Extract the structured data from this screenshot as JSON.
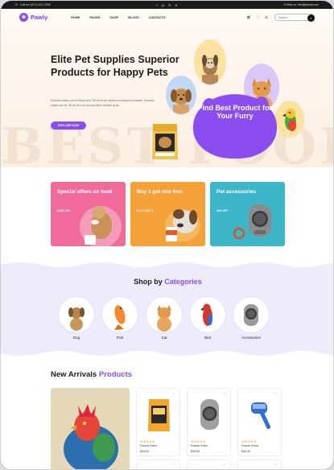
{
  "topbar": {
    "phone": "Call us: (617) 422-2236",
    "email": "Mail us: info@pawly.com",
    "social_icons": [
      "facebook-icon",
      "instagram-icon",
      "pinterest-icon",
      "x-icon"
    ]
  },
  "header": {
    "logo": "Pawly",
    "nav": [
      "HOME",
      "PAGES",
      "SHOP",
      "BLOGS",
      "CONTACTS"
    ],
    "icons": [
      "cart-icon",
      "heart-icon",
      "user-icon"
    ],
    "search_placeholder": "Search...",
    "search_icon": "search-icon"
  },
  "hero": {
    "title": "Elite Pet Supplies Superior Products for Happy Pets",
    "description": "Exerties nobis cum et libero tem. Sit vel id rel dante et ut eliquo te molette. Exerties nobis cum et. Sit rel cim est ad mon elem sit lima ut ae.",
    "cta": "EXPLORE NOW",
    "paw_text": "Find Best Product for Your Furry",
    "watermark": "BEST FOOD",
    "colors": {
      "accent": "#8a4cf0",
      "bubble_yellow": "#fbe2a0",
      "bubble_purple": "#d9c8f8",
      "bubble_blue": "#bfd9f5"
    }
  },
  "offers": [
    {
      "title": "Special offers on food",
      "subtitle": "SAVE 20%",
      "color": "#f06b9a"
    },
    {
      "title": "Buy 1 get one free",
      "subtitle": "BUY 1 GET 1",
      "color": "#f5a13a"
    },
    {
      "title": "Pet accessories",
      "subtitle": "20% OFF",
      "color": "#3db6c9"
    }
  ],
  "categories": {
    "title_plain": "Shop by",
    "title_accent": "Categories",
    "items": [
      "Dog",
      "Fish",
      "Cat",
      "Bird",
      "Accessories"
    ]
  },
  "arrivals": {
    "title_plain": "New Arrivals",
    "title_accent": "Products",
    "products": [
      {
        "name": "Freeze Dried",
        "price": "$49.00",
        "stars": "★★★★★"
      },
      {
        "name": "Freeze Dried",
        "price": "$49.00",
        "stars": "★★★★★"
      },
      {
        "name": "Freeze Dried",
        "price": "$49.00",
        "stars": "★★★★★"
      }
    ]
  }
}
